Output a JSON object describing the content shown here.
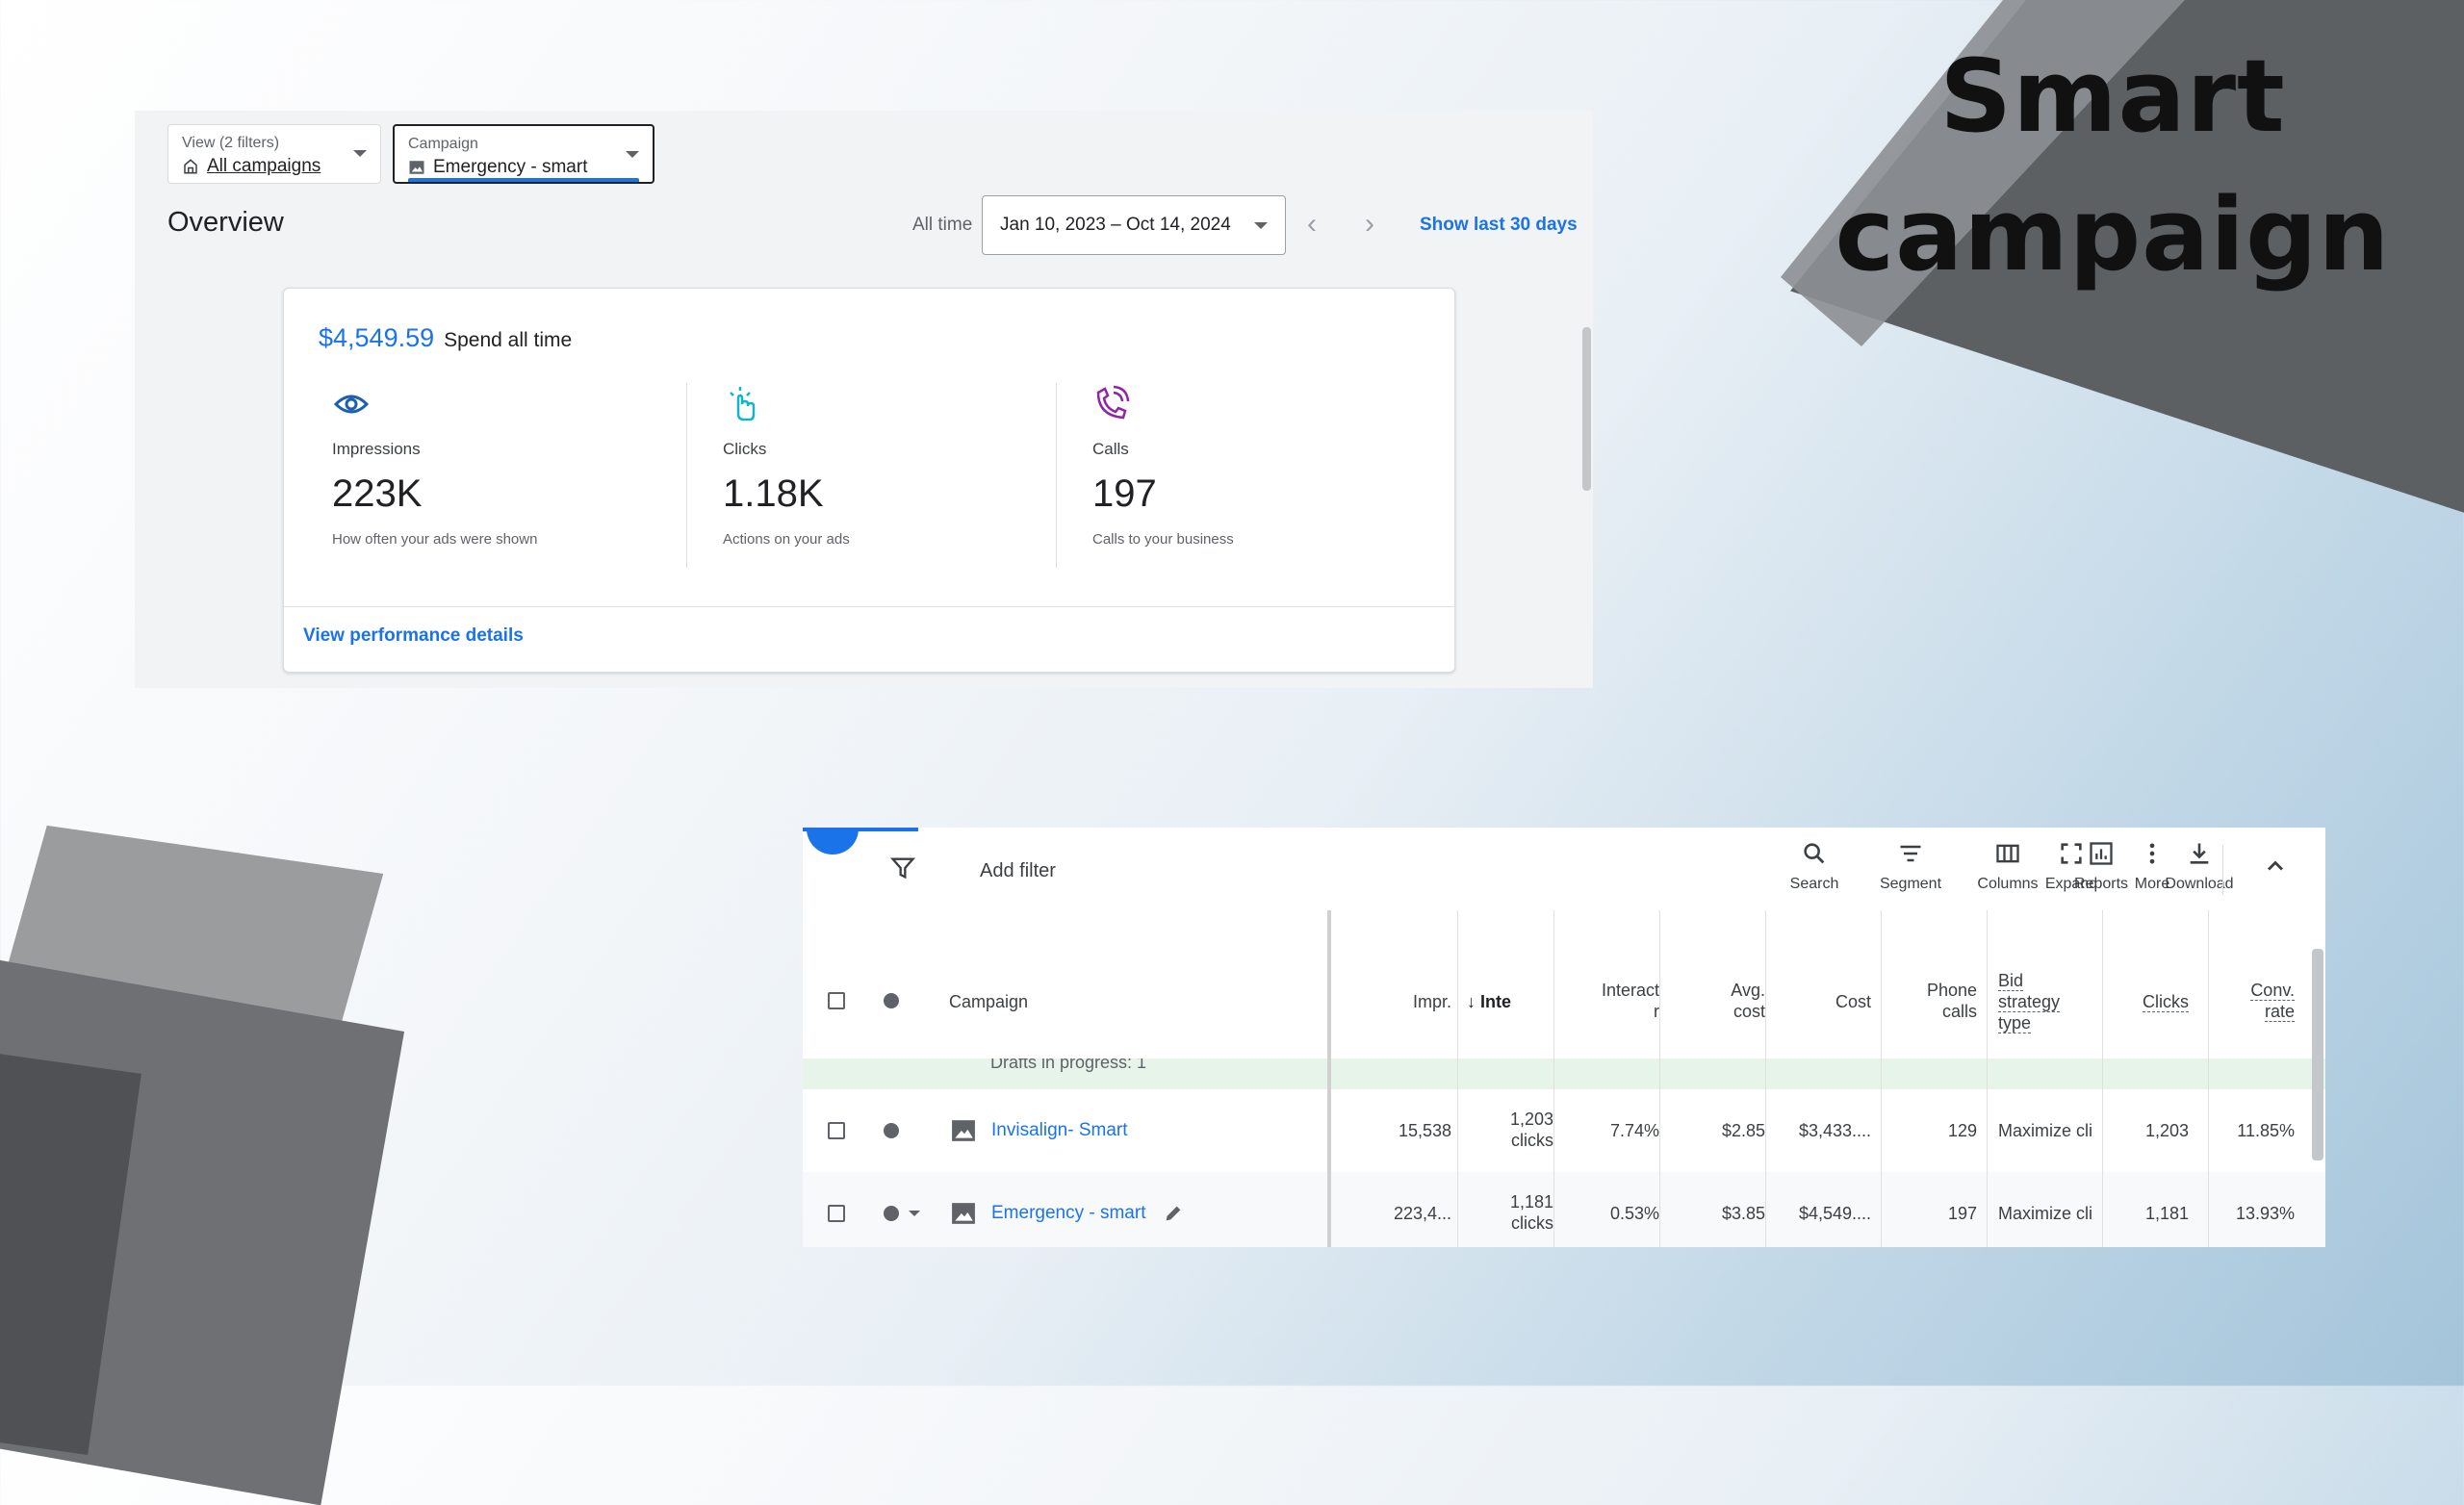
{
  "hero": {
    "line1": "Smart",
    "line2": "campaign"
  },
  "filters": {
    "view_caption": "View (2 filters)",
    "view_value": "All campaigns",
    "campaign_caption": "Campaign",
    "campaign_value": "Emergency - smart"
  },
  "overview": {
    "title": "Overview",
    "all_time": "All time",
    "date_range": "Jan 10, 2023 – Oct 14, 2024",
    "show_last": "Show last 30 days"
  },
  "summary": {
    "spend_amount": "$4,549.59",
    "spend_label": "Spend all time",
    "metrics": [
      {
        "label": "Impressions",
        "value": "223K",
        "desc": "How often your ads were shown"
      },
      {
        "label": "Clicks",
        "value": "1.18K",
        "desc": "Actions on your ads"
      },
      {
        "label": "Calls",
        "value": "197",
        "desc": "Calls to your business"
      }
    ],
    "link": "View performance details"
  },
  "toolbar": {
    "add_filter": "Add filter",
    "tools": [
      "Search",
      "Segment",
      "Columns",
      "Reports",
      "Download",
      "Expand",
      "More"
    ]
  },
  "table": {
    "headers": {
      "campaign": "Campaign",
      "impr": "Impr.",
      "inte": "Inte",
      "interact_1": "Interact",
      "interact_2": "r",
      "avgcost_1": "Avg.",
      "avgcost_2": "cost",
      "cost": "Cost",
      "phone_1": "Phone",
      "phone_2": "calls",
      "bid_1": "Bid",
      "bid_2": "strategy",
      "bid_3": "type",
      "clicks": "Clicks",
      "conv_1": "Conv.",
      "conv_2": "rate"
    },
    "draft_text": "Drafts in progress: 1",
    "rows": [
      {
        "campaign": "Invisalign- Smart",
        "impr": "15,538",
        "inte_1": "1,203",
        "inte_2": "clicks",
        "interact": "7.74%",
        "avg_cost": "$2.85",
        "cost": "$3,433....",
        "phone_calls": "129",
        "bid": "Maximize cli",
        "clicks": "1,203",
        "conv_rate": "11.85%"
      },
      {
        "campaign": "Emergency - smart",
        "impr": "223,4...",
        "inte_1": "1,181",
        "inte_2": "clicks",
        "interact": "0.53%",
        "avg_cost": "$3.85",
        "cost": "$4,549....",
        "phone_calls": "197",
        "bid": "Maximize cli",
        "clicks": "1,181",
        "conv_rate": "13.93%"
      }
    ]
  },
  "colors": {
    "accent": "#1a73e8",
    "calls_icon": "#8e24aa",
    "clicks_icon": "#12b5cb",
    "impr_icon": "#1a5fb4"
  }
}
